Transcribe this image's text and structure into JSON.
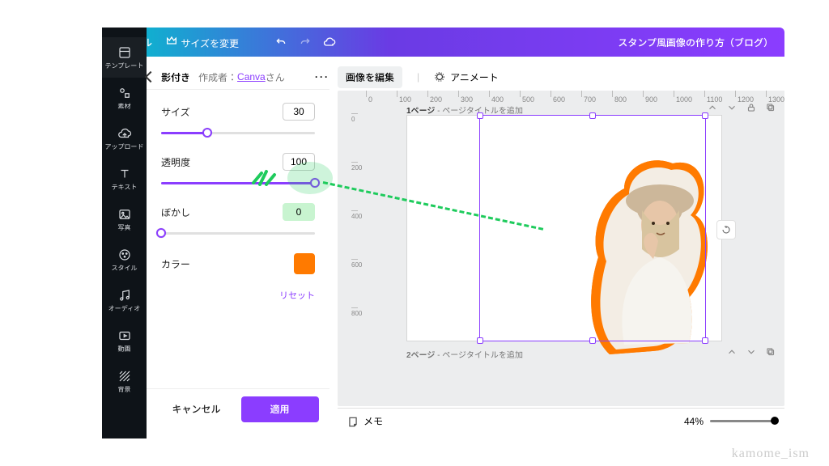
{
  "topbar": {
    "file": "ファイル",
    "resize": "サイズを変更",
    "title": "スタンプ風画像の作り方（ブログ）"
  },
  "vnav": [
    {
      "id": "template",
      "label": "テンプレート"
    },
    {
      "id": "elements",
      "label": "素材"
    },
    {
      "id": "upload",
      "label": "アップロード"
    },
    {
      "id": "text",
      "label": "テキスト"
    },
    {
      "id": "photo",
      "label": "写真"
    },
    {
      "id": "style",
      "label": "スタイル"
    },
    {
      "id": "audio",
      "label": "オーディオ"
    },
    {
      "id": "video",
      "label": "動画"
    },
    {
      "id": "bg",
      "label": "背景"
    }
  ],
  "panel": {
    "title": "影付き",
    "author_label": "作成者：",
    "author_link": "Canva",
    "author_suffix": "さん",
    "props": {
      "size": {
        "label": "サイズ",
        "value": 30,
        "pct": 30
      },
      "opacity": {
        "label": "透明度",
        "value": 100,
        "pct": 100
      },
      "blur": {
        "label": "ぼかし",
        "value": 0,
        "pct": 0
      },
      "color": {
        "label": "カラー",
        "hex": "#ff7a00"
      }
    },
    "reset": "リセット",
    "cancel": "キャンセル",
    "apply": "適用"
  },
  "ctxbar": {
    "edit_image": "画像を編集",
    "animate": "アニメート"
  },
  "canvas": {
    "ruler_ticks": [
      0,
      100,
      200,
      300,
      400,
      500,
      600,
      700,
      800,
      900,
      1000,
      1100,
      1200,
      1300
    ],
    "ruler_vticks": [
      0,
      200,
      400,
      600,
      800
    ],
    "page1_prefix": "1ページ",
    "page2_prefix": "2ページ",
    "page_title_hint": " - ページタイトルを追加"
  },
  "bottombar": {
    "notes": "メモ",
    "zoom": "44%"
  },
  "watermark": "kamome_ism"
}
